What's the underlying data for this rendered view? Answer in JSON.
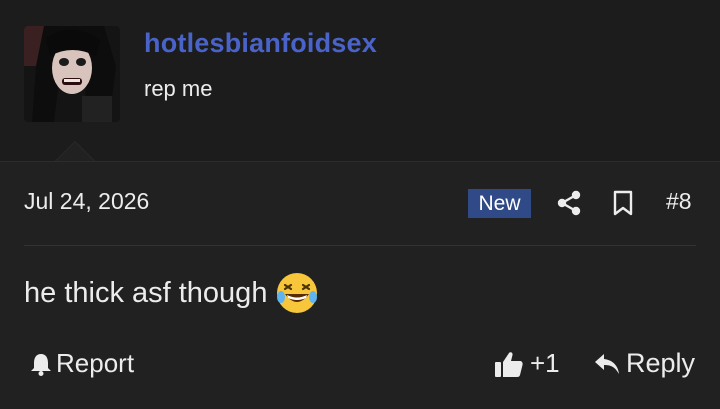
{
  "author": {
    "username": "hotlesbianfoidsex",
    "user_title": "rep me",
    "username_color": "#4a63c8"
  },
  "post": {
    "date": "Jul 24, 2026",
    "badge": "New",
    "number": "#8",
    "message": "he thick asf though",
    "emoji": "rolling-on-floor-laughing-emoji"
  },
  "actions": {
    "report_label": "Report",
    "like_count": "+1",
    "reply_label": "Reply"
  },
  "icons": [
    "share-icon",
    "bookmark-icon",
    "bell-icon",
    "thumbs-up-icon",
    "reply-arrow-icon"
  ]
}
